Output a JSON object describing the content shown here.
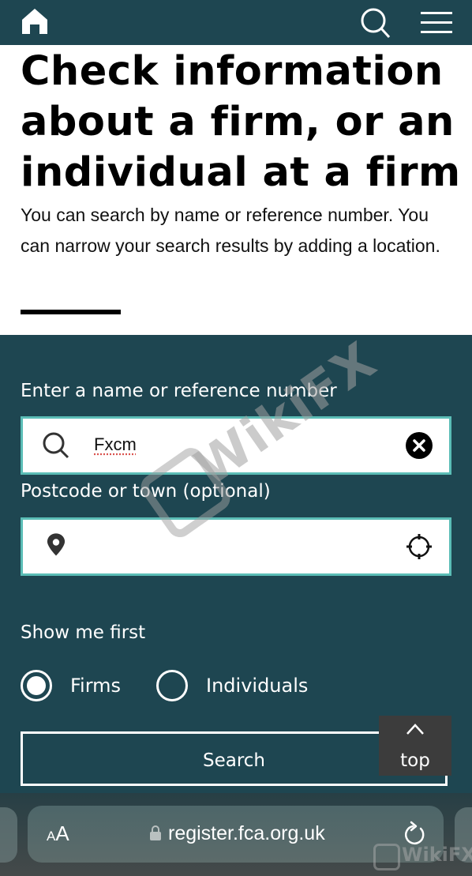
{
  "topbar": {
    "home_icon": "home-icon",
    "search_icon": "search-icon",
    "menu_icon": "hamburger-menu-icon"
  },
  "header": {
    "title": "Check information about a firm, or an individual at a firm",
    "intro": "You can search by name or reference number. You can narrow your search results by adding a location."
  },
  "form": {
    "name_label": "Enter a name or reference number",
    "name_value": "Fxcm",
    "name_icon": "search-icon",
    "clear_icon": "clear-icon",
    "location_label": "Postcode or town (optional)",
    "location_value": "",
    "location_icon": "map-pin-icon",
    "locate_icon": "crosshair-icon",
    "show_first_label": "Show me first",
    "radios": [
      {
        "label": "Firms",
        "checked": true
      },
      {
        "label": "Individuals",
        "checked": false
      }
    ],
    "search_button": "Search",
    "back_to_top": "top"
  },
  "browser": {
    "text_size_small": "A",
    "text_size_big": "A",
    "url": "register.fca.org.uk",
    "reload_icon": "reload-icon",
    "lock_icon": "lock-icon"
  },
  "watermark": {
    "text": "WikiFX"
  },
  "colors": {
    "brand_dark_teal": "#1e4651",
    "input_border": "#5bbdb6",
    "top_button_bg": "#3c3c3c"
  }
}
